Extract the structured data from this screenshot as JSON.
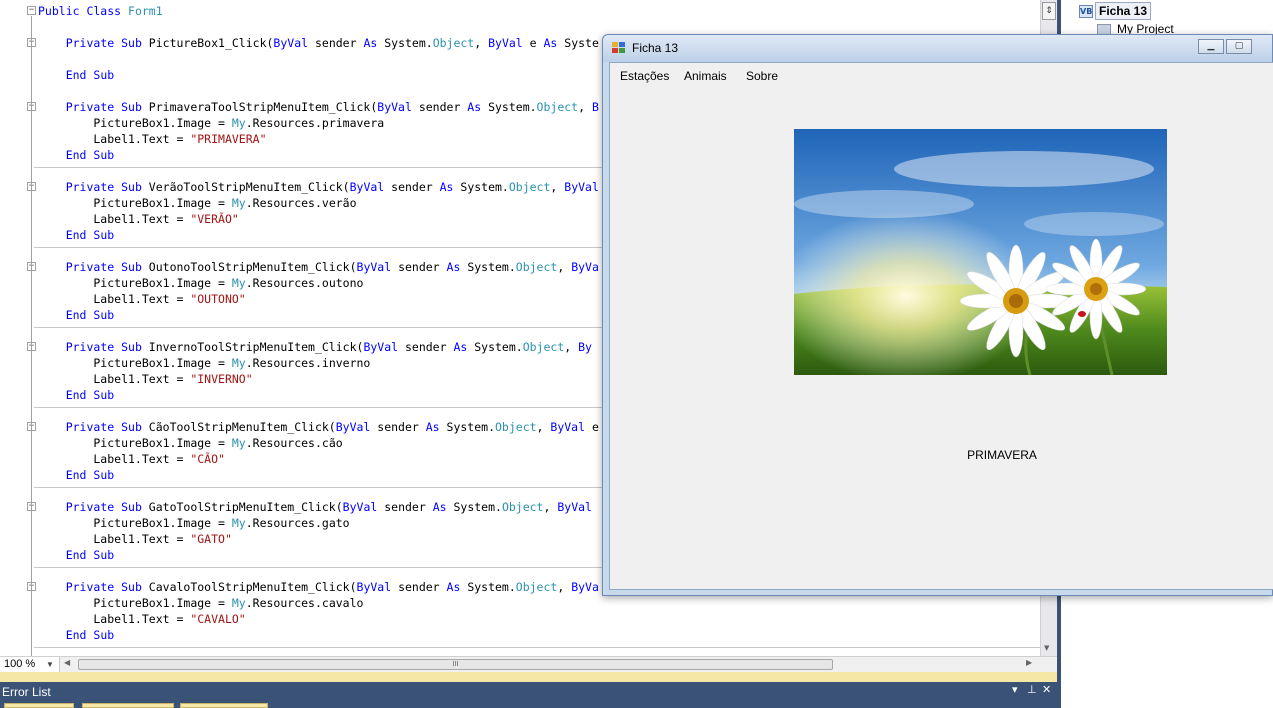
{
  "editor": {
    "lines": [
      [
        [
          "kw",
          "Public Class "
        ],
        [
          "ty",
          "Form1"
        ]
      ],
      [],
      [
        [
          "",
          "    "
        ],
        [
          "kw",
          "Private Sub "
        ],
        [
          "",
          "PictureBox1_Click("
        ],
        [
          "kw",
          "ByVal "
        ],
        [
          "",
          "sender "
        ],
        [
          "kw",
          "As "
        ],
        [
          "",
          "System."
        ],
        [
          "ty",
          "Object"
        ],
        [
          "",
          ", "
        ],
        [
          "kw",
          "ByVal "
        ],
        [
          "",
          "e "
        ],
        [
          "kw",
          "As "
        ],
        [
          "",
          "Syste"
        ]
      ],
      [],
      [
        [
          "",
          "    "
        ],
        [
          "kw",
          "End Sub"
        ]
      ],
      [],
      [
        [
          "",
          "    "
        ],
        [
          "kw",
          "Private Sub "
        ],
        [
          "",
          "PrimaveraToolStripMenuItem_Click("
        ],
        [
          "kw",
          "ByVal "
        ],
        [
          "",
          "sender "
        ],
        [
          "kw",
          "As "
        ],
        [
          "",
          "System."
        ],
        [
          "ty",
          "Object"
        ],
        [
          "",
          ", "
        ],
        [
          "kw",
          "B"
        ]
      ],
      [
        [
          "",
          "        PictureBox1.Image = "
        ],
        [
          "ty",
          "My"
        ],
        [
          "",
          ".Resources.primavera"
        ]
      ],
      [
        [
          "",
          "        Label1.Text = "
        ],
        [
          "st",
          "\"PRIMAVERA\""
        ]
      ],
      [
        [
          "",
          "    "
        ],
        [
          "kw",
          "End Sub"
        ]
      ],
      [],
      [
        [
          "",
          "    "
        ],
        [
          "kw",
          "Private Sub "
        ],
        [
          "",
          "VerãoToolStripMenuItem_Click("
        ],
        [
          "kw",
          "ByVal "
        ],
        [
          "",
          "sender "
        ],
        [
          "kw",
          "As "
        ],
        [
          "",
          "System."
        ],
        [
          "ty",
          "Object"
        ],
        [
          "",
          ", "
        ],
        [
          "kw",
          "ByVal"
        ]
      ],
      [
        [
          "",
          "        PictureBox1.Image = "
        ],
        [
          "ty",
          "My"
        ],
        [
          "",
          ".Resources.verão"
        ]
      ],
      [
        [
          "",
          "        Label1.Text = "
        ],
        [
          "st",
          "\"VERÃO\""
        ]
      ],
      [
        [
          "",
          "    "
        ],
        [
          "kw",
          "End Sub"
        ]
      ],
      [],
      [
        [
          "",
          "    "
        ],
        [
          "kw",
          "Private Sub "
        ],
        [
          "",
          "OutonoToolStripMenuItem_Click("
        ],
        [
          "kw",
          "ByVal "
        ],
        [
          "",
          "sender "
        ],
        [
          "kw",
          "As "
        ],
        [
          "",
          "System."
        ],
        [
          "ty",
          "Object"
        ],
        [
          "",
          ", "
        ],
        [
          "kw",
          "ByVa"
        ]
      ],
      [
        [
          "",
          "        PictureBox1.Image = "
        ],
        [
          "ty",
          "My"
        ],
        [
          "",
          ".Resources.outono"
        ]
      ],
      [
        [
          "",
          "        Label1.Text = "
        ],
        [
          "st",
          "\"OUTONO\""
        ]
      ],
      [
        [
          "",
          "    "
        ],
        [
          "kw",
          "End Sub"
        ]
      ],
      [],
      [
        [
          "",
          "    "
        ],
        [
          "kw",
          "Private Sub "
        ],
        [
          "",
          "InvernoToolStripMenuItem_Click("
        ],
        [
          "kw",
          "ByVal "
        ],
        [
          "",
          "sender "
        ],
        [
          "kw",
          "As "
        ],
        [
          "",
          "System."
        ],
        [
          "ty",
          "Object"
        ],
        [
          "",
          ", "
        ],
        [
          "kw",
          "By"
        ]
      ],
      [
        [
          "",
          "        PictureBox1.Image = "
        ],
        [
          "ty",
          "My"
        ],
        [
          "",
          ".Resources.inverno"
        ]
      ],
      [
        [
          "",
          "        Label1.Text = "
        ],
        [
          "st",
          "\"INVERNO\""
        ]
      ],
      [
        [
          "",
          "    "
        ],
        [
          "kw",
          "End Sub"
        ]
      ],
      [],
      [
        [
          "",
          "    "
        ],
        [
          "kw",
          "Private Sub "
        ],
        [
          "",
          "CãoToolStripMenuItem_Click("
        ],
        [
          "kw",
          "ByVal "
        ],
        [
          "",
          "sender "
        ],
        [
          "kw",
          "As "
        ],
        [
          "",
          "System."
        ],
        [
          "ty",
          "Object"
        ],
        [
          "",
          ", "
        ],
        [
          "kw",
          "ByVal "
        ],
        [
          "",
          "e"
        ]
      ],
      [
        [
          "",
          "        PictureBox1.Image = "
        ],
        [
          "ty",
          "My"
        ],
        [
          "",
          ".Resources.cão"
        ]
      ],
      [
        [
          "",
          "        Label1.Text = "
        ],
        [
          "st",
          "\"CÃO\""
        ]
      ],
      [
        [
          "",
          "    "
        ],
        [
          "kw",
          "End Sub"
        ]
      ],
      [],
      [
        [
          "",
          "    "
        ],
        [
          "kw",
          "Private Sub "
        ],
        [
          "",
          "GatoToolStripMenuItem_Click("
        ],
        [
          "kw",
          "ByVal "
        ],
        [
          "",
          "sender "
        ],
        [
          "kw",
          "As "
        ],
        [
          "",
          "System."
        ],
        [
          "ty",
          "Object"
        ],
        [
          "",
          ", "
        ],
        [
          "kw",
          "ByVal"
        ]
      ],
      [
        [
          "",
          "        PictureBox1.Image = "
        ],
        [
          "ty",
          "My"
        ],
        [
          "",
          ".Resources.gato"
        ]
      ],
      [
        [
          "",
          "        Label1.Text = "
        ],
        [
          "st",
          "\"GATO\""
        ]
      ],
      [
        [
          "",
          "    "
        ],
        [
          "kw",
          "End Sub"
        ]
      ],
      [],
      [
        [
          "",
          "    "
        ],
        [
          "kw",
          "Private Sub "
        ],
        [
          "",
          "CavaloToolStripMenuItem_Click("
        ],
        [
          "kw",
          "ByVal "
        ],
        [
          "",
          "sender "
        ],
        [
          "kw",
          "As "
        ],
        [
          "",
          "System."
        ],
        [
          "ty",
          "Object"
        ],
        [
          "",
          ", "
        ],
        [
          "kw",
          "ByVa"
        ]
      ],
      [
        [
          "",
          "        PictureBox1.Image = "
        ],
        [
          "ty",
          "My"
        ],
        [
          "",
          ".Resources.cavalo"
        ]
      ],
      [
        [
          "",
          "        Label1.Text = "
        ],
        [
          "st",
          "\"CAVALO\""
        ]
      ],
      [
        [
          "",
          "    "
        ],
        [
          "kw",
          "End Sub"
        ]
      ]
    ],
    "folds": [
      0,
      2,
      6,
      11,
      16,
      21,
      26,
      31,
      36
    ],
    "separators": [
      9,
      14,
      19,
      24,
      29,
      34,
      39
    ],
    "zoom": "100 %",
    "split_glyph": "⇕",
    "scroll_grip": "III"
  },
  "error_list": {
    "title": "Error List",
    "pin_glyph": "▾",
    "autohide_glyph": "⊥",
    "close_glyph": "✕"
  },
  "solution_explorer": {
    "root": "Ficha 13",
    "root_icon": "VB",
    "project": "My Project"
  },
  "form": {
    "title": "Ficha 13",
    "menu": [
      "Estações",
      "Animais",
      "Sobre"
    ],
    "label": "PRIMAVERA",
    "minimize_glyph": "▁",
    "maximize_glyph": "▢",
    "picture": "spring-meadow-daisies"
  },
  "colors": {
    "keyword": "#0000ff",
    "type": "#2b91af",
    "string": "#a31515",
    "tool_header": "#3b5277"
  }
}
